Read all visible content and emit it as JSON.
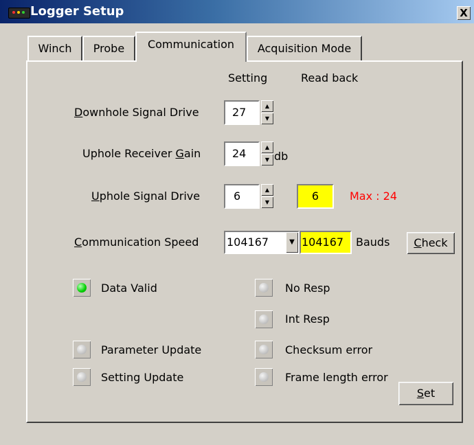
{
  "window": {
    "title": "Logger Setup",
    "close_glyph": "X"
  },
  "tabs": [
    {
      "label": "Winch",
      "active": false
    },
    {
      "label": "Probe",
      "active": false
    },
    {
      "label": "Communication",
      "active": true
    },
    {
      "label": "Acquisition Mode",
      "active": false
    }
  ],
  "columns": {
    "setting": "Setting",
    "read_back": "Read back"
  },
  "fields": {
    "downhole_drive": {
      "label_pre": "",
      "label_key": "D",
      "label_post": "ownhole Signal Drive",
      "value": "27"
    },
    "uphole_gain": {
      "label_pre": "Uphole Receiver ",
      "label_key": "G",
      "label_post": "ain",
      "value": "24",
      "unit": "db"
    },
    "uphole_drive": {
      "label_pre": "",
      "label_key": "U",
      "label_post": "phole Signal Drive",
      "value": "6",
      "readback": "6",
      "max_text": "Max : 24"
    },
    "comm_speed": {
      "label_pre": "",
      "label_key": "C",
      "label_post": "ommunication Speed",
      "value": "104167",
      "readback": "104167",
      "unit": "Bauds"
    }
  },
  "buttons": {
    "check": {
      "key": "C",
      "rest": "heck"
    },
    "set": {
      "key": "S",
      "rest": "et"
    }
  },
  "indicators": [
    {
      "label": "Data Valid",
      "on": true
    },
    {
      "label": "No Resp",
      "on": false
    },
    {
      "label": "Int Resp",
      "on": false
    },
    {
      "label": "Parameter Update",
      "on": false
    },
    {
      "label": "Checksum error",
      "on": false
    },
    {
      "label": "Setting Update",
      "on": false
    },
    {
      "label": "Frame length error",
      "on": false
    }
  ],
  "colors": {
    "readback_bg": "#ffff00",
    "max_text": "#ff0000",
    "led_on": "#00d000",
    "led_off": "#c0c0c0"
  },
  "icons": {
    "window_icon": "logger-device-icon",
    "spin_up": "spin-up-arrow-icon",
    "spin_down": "spin-down-arrow-icon",
    "dropdown": "dropdown-arrow-icon"
  }
}
